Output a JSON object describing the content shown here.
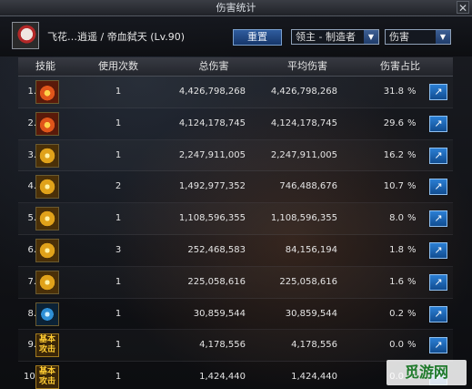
{
  "window": {
    "title": "伤害统计",
    "close_label": "✕"
  },
  "header": {
    "player_name": "飞花…逍遥 / 帝血弑天 (Lv.90)",
    "reset_label": "重置",
    "target_select": "领主 - 制造者",
    "metric_select": "伤害"
  },
  "table": {
    "columns": {
      "skill": "技能",
      "uses": "使用次数",
      "total": "总伤害",
      "avg": "平均伤害",
      "share": "伤害占比"
    },
    "rows": [
      {
        "rank": "1.",
        "uses": "1",
        "total": "4,426,798,268",
        "avg": "4,426,798,268",
        "pct": "31.8",
        "unit": "%",
        "icon": "fire-slash-skill-icon",
        "style": "fire"
      },
      {
        "rank": "2.",
        "uses": "1",
        "total": "4,124,178,745",
        "avg": "4,124,178,745",
        "pct": "29.6",
        "unit": "%",
        "icon": "flame-burst-skill-icon",
        "style": "fire"
      },
      {
        "rank": "3.",
        "uses": "1",
        "total": "2,247,911,005",
        "avg": "2,247,911,005",
        "pct": "16.2",
        "unit": "%",
        "icon": "gold-slash-skill-icon",
        "style": "gold"
      },
      {
        "rank": "4.",
        "uses": "2",
        "total": "1,492,977,352",
        "avg": "746,488,676",
        "pct": "10.7",
        "unit": "%",
        "icon": "gold-wave-skill-icon",
        "style": "gold"
      },
      {
        "rank": "5.",
        "uses": "1",
        "total": "1,108,596,355",
        "avg": "1,108,596,355",
        "pct": "8.0",
        "unit": "%",
        "icon": "sword-strike-skill-icon",
        "style": "gold"
      },
      {
        "rank": "6.",
        "uses": "3",
        "total": "252,468,583",
        "avg": "84,156,194",
        "pct": "1.8",
        "unit": "%",
        "icon": "ground-spike-skill-icon",
        "style": "gold"
      },
      {
        "rank": "7.",
        "uses": "1",
        "total": "225,058,616",
        "avg": "225,058,616",
        "pct": "1.6",
        "unit": "%",
        "icon": "star-burst-skill-icon",
        "style": "gold"
      },
      {
        "rank": "8.",
        "uses": "1",
        "total": "30,859,544",
        "avg": "30,859,544",
        "pct": "0.2",
        "unit": "%",
        "icon": "blue-orb-skill-icon",
        "style": "blue"
      },
      {
        "rank": "9.",
        "uses": "1",
        "total": "4,178,556",
        "avg": "4,178,556",
        "pct": "0.0",
        "unit": "%",
        "icon": "basic-attack-skill-icon",
        "style": "text",
        "icon_text": "基本攻击"
      },
      {
        "rank": "10.",
        "uses": "1",
        "total": "1,424,440",
        "avg": "1,424,440",
        "pct": "0.0",
        "unit": "%",
        "icon": "basic-attack-skill-icon",
        "style": "text",
        "icon_text": "基本攻击"
      }
    ]
  },
  "watermark": "觅游网"
}
